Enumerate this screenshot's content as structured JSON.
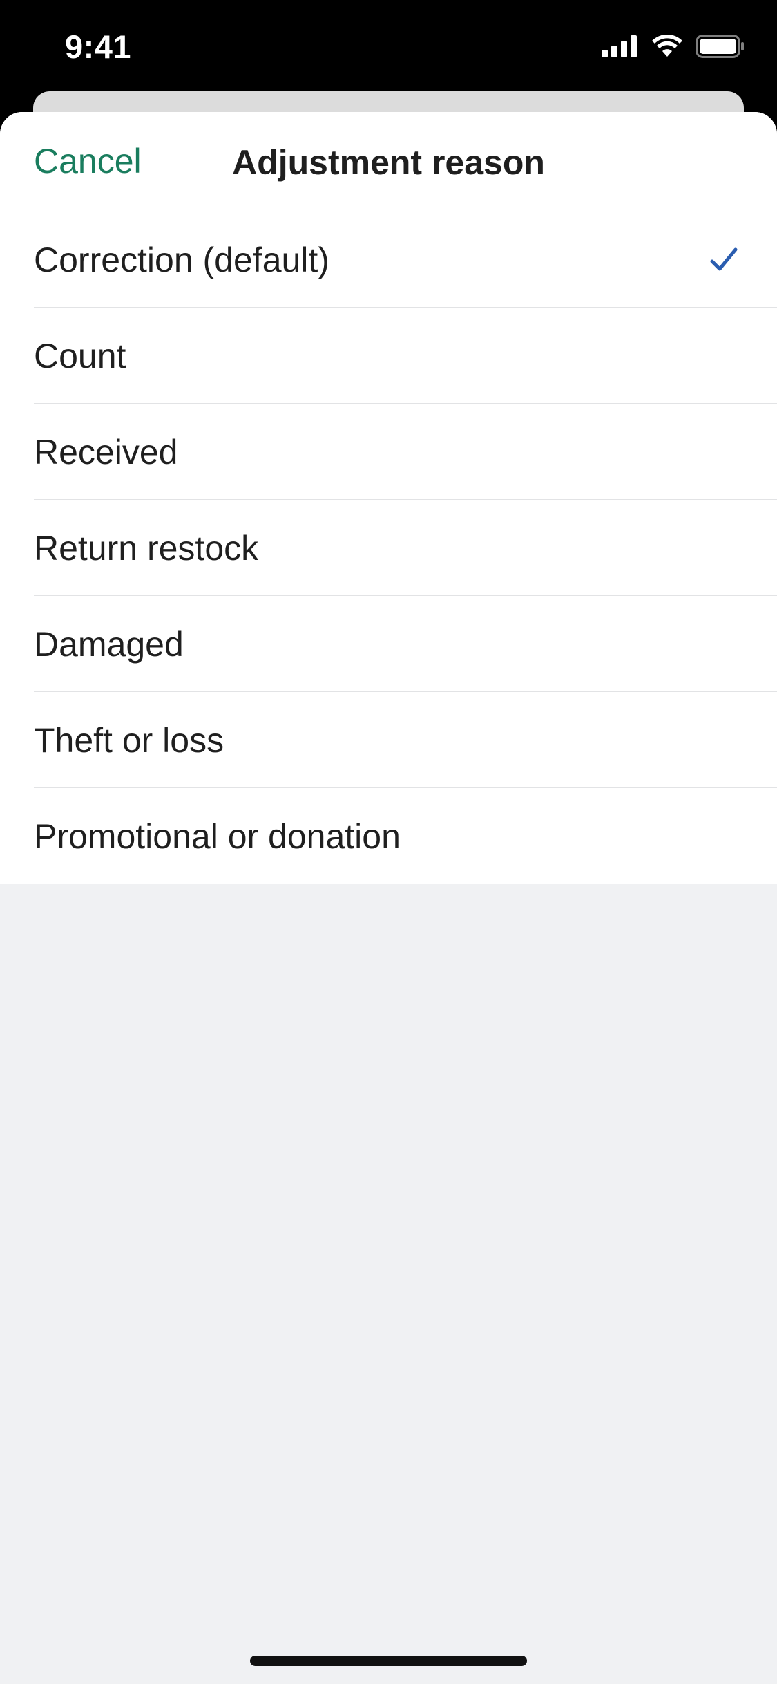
{
  "status_bar": {
    "time": "9:41"
  },
  "sheet": {
    "cancel_label": "Cancel",
    "title": "Adjustment reason",
    "options": [
      {
        "label": "Correction (default)",
        "selected": true
      },
      {
        "label": "Count",
        "selected": false
      },
      {
        "label": "Received",
        "selected": false
      },
      {
        "label": "Return restock",
        "selected": false
      },
      {
        "label": "Damaged",
        "selected": false
      },
      {
        "label": "Theft or loss",
        "selected": false
      },
      {
        "label": "Promotional or donation",
        "selected": false
      }
    ]
  },
  "colors": {
    "accent": "#1a7d5e",
    "check": "#2a5db0",
    "background": "#f0f1f3"
  },
  "icons": {
    "status": [
      "signal-icon",
      "wifi-icon",
      "battery-icon"
    ],
    "selected_marker": "checkmark-icon"
  }
}
